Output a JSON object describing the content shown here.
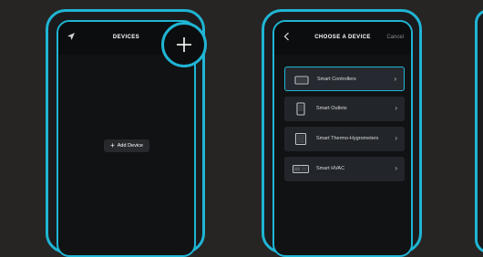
{
  "screen_left": {
    "title": "DEVICES",
    "nav_icon": "location-arrow-icon",
    "add_button_label": "Add Device",
    "add_icon": "plus-icon",
    "zoom_plus_icon": "plus-icon"
  },
  "screen_right": {
    "title": "CHOOSE A DEVICE",
    "back_icon": "chevron-left-icon",
    "cancel_label": "Cancel",
    "devices": [
      {
        "label": "Smart Controllers",
        "icon": "controller-icon",
        "selected": true
      },
      {
        "label": "Smart Outlets",
        "icon": "outlet-icon",
        "selected": false
      },
      {
        "label": "Smart Thermo-Hygrometers",
        "icon": "thermo-hygrometer-icon",
        "selected": false
      },
      {
        "label": "Smart HVAC",
        "icon": "hvac-icon",
        "selected": false
      }
    ]
  },
  "colors": {
    "accent": "#1fb5d4",
    "background": "#272424",
    "screen": "#111214",
    "row": "#22252a"
  }
}
